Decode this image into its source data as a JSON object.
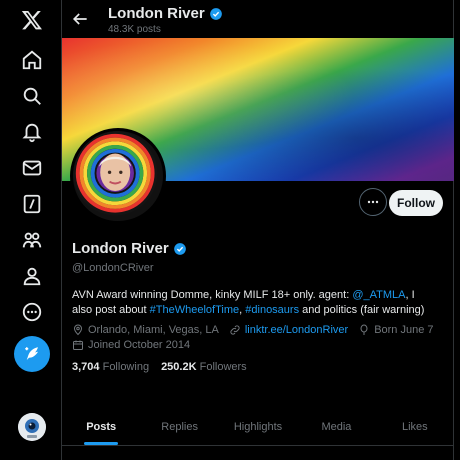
{
  "header": {
    "title": "London River",
    "subtitle": "48.3K posts"
  },
  "profile": {
    "name": "London River",
    "handle": "@LondonCRiver",
    "follow_label": "Follow",
    "bio": {
      "t1": "AVN Award winning Domme, kinky MILF 18+ only. agent: ",
      "l1": "@_ATMLA",
      "t2": ", I also post about ",
      "l2": "#TheWheelofTime",
      "t3": ", ",
      "l3": "#dinosaurs",
      "t4": " and politics (fair warning)"
    },
    "location": "Orlando, Miami, Vegas, LA",
    "website": "linktr.ee/LondonRiver",
    "birthday": "Born June 7",
    "joined": "Joined October 2014",
    "following_count": "3,704",
    "following_label": "Following",
    "followers_count": "250.2K",
    "followers_label": "Followers"
  },
  "tabs": [
    {
      "label": "Posts"
    },
    {
      "label": "Replies"
    },
    {
      "label": "Highlights"
    },
    {
      "label": "Media"
    },
    {
      "label": "Likes"
    }
  ],
  "nav_icons": [
    "x-logo-icon",
    "home-icon",
    "search-icon",
    "notifications-icon",
    "messages-icon",
    "grok-icon",
    "communities-icon",
    "profile-icon",
    "more-icon",
    "compose-icon"
  ],
  "colors": {
    "accent": "#1d9bf0",
    "background": "#000000",
    "muted": "#71767b"
  }
}
